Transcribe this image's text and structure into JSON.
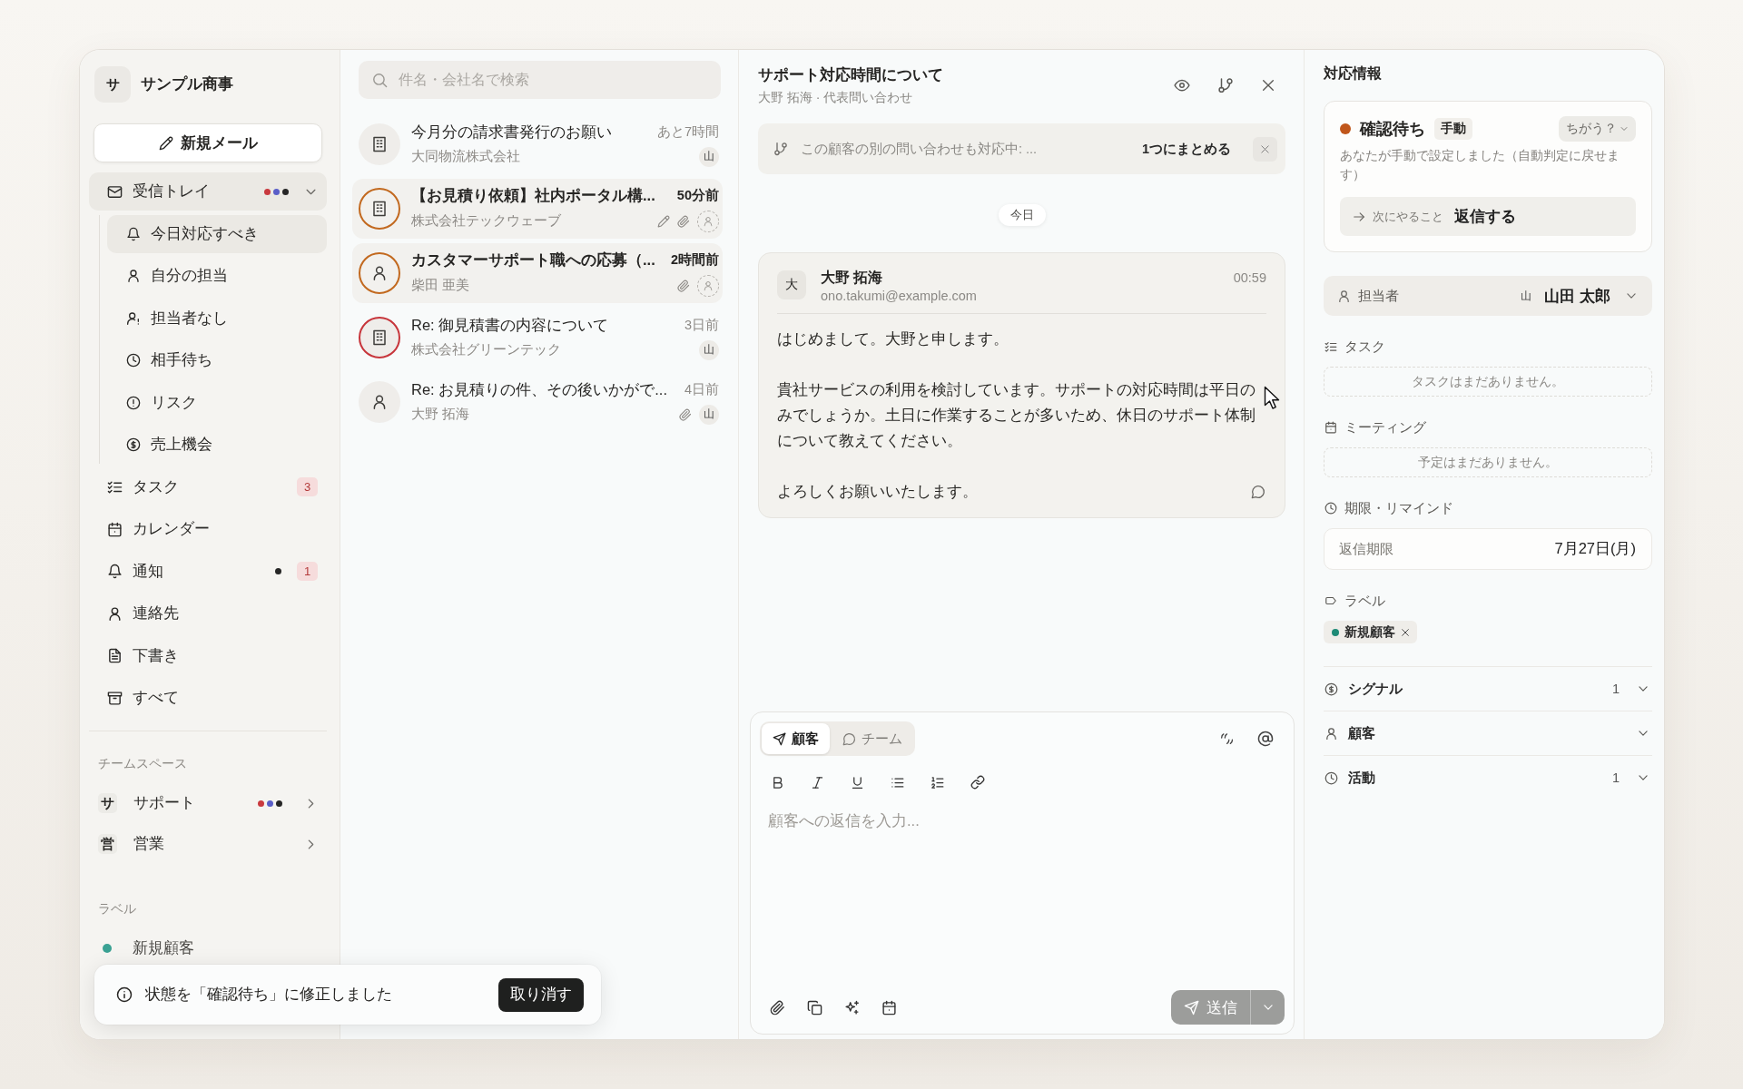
{
  "sidebar": {
    "workspace": {
      "initial": "サ",
      "name": "サンプル商事"
    },
    "compose_button": "新規メール",
    "folders": [
      {
        "label": "受信トレイ",
        "selected": true,
        "expanded": true,
        "dots": [
          {
            "color": "#c93a3f"
          },
          {
            "color": "#5a5ec8"
          },
          {
            "color": "#262626"
          }
        ],
        "children": [
          {
            "label": "今日対応すべき",
            "selected": true
          },
          {
            "label": "自分の担当",
            "selected": false
          },
          {
            "label": "担当者なし",
            "selected": false
          },
          {
            "label": "相手待ち",
            "selected": false
          },
          {
            "label": "リスク",
            "selected": false
          },
          {
            "label": "売上機会",
            "selected": false
          }
        ]
      },
      {
        "label": "タスク",
        "selected": false,
        "badge": "3"
      },
      {
        "label": "カレンダー",
        "selected": false
      },
      {
        "label": "通知",
        "selected": false,
        "dots": [
          {
            "color": "#262626"
          }
        ],
        "badge": "1"
      },
      {
        "label": "連絡先",
        "selected": false
      },
      {
        "label": "下書き",
        "selected": false
      },
      {
        "label": "すべて",
        "selected": false
      }
    ],
    "team_heading": "チームスペース",
    "teams": [
      {
        "initial": "サ",
        "label": "サポート",
        "expanded": false,
        "dots": [
          {
            "color": "#c93a3f"
          },
          {
            "color": "#5a5ec8"
          },
          {
            "color": "#262626"
          }
        ]
      },
      {
        "initial": "営",
        "label": "営業",
        "expanded": false
      }
    ],
    "labels_heading": "ラベル",
    "labels": [
      {
        "label": "新規顧客",
        "color": "#3aa193"
      }
    ]
  },
  "toast": {
    "message": "状態を「確認待ち」に修正しました",
    "action": "取り消す"
  },
  "threads": {
    "search_placeholder": "件名・会社名で検索",
    "items": [
      {
        "kind": "company",
        "subject": "今月分の請求書発行のお願い",
        "sender": "大同物流株式会社",
        "time": "あと7時間",
        "unread": false,
        "draft": false,
        "attachment": false,
        "assignee": "山"
      },
      {
        "kind": "company",
        "color": "#c2691f",
        "subject": "【お見積り依頼】社内ポータル構...",
        "sender": "株式会社テックウェーブ",
        "time": "50分前",
        "unread": true,
        "draft": true,
        "attachment": true
      },
      {
        "kind": "person",
        "color": "#c2691f",
        "subject": "カスタマーサポート職への応募（...",
        "sender": "柴田 亜美",
        "time": "2時間前",
        "unread": true,
        "draft": false,
        "attachment": true
      },
      {
        "kind": "company",
        "color": "#c7353b",
        "subject": "Re: 御見積書の内容について",
        "sender": "株式会社グリーンテック",
        "time": "3日前",
        "unread": false,
        "draft": false,
        "attachment": false,
        "assignee": "山"
      },
      {
        "kind": "person",
        "subject": "Re: お見積りの件、その後いかがで...",
        "sender": "大野 拓海",
        "time": "4日前",
        "unread": false,
        "draft": false,
        "attachment": true,
        "assignee": "山"
      }
    ]
  },
  "conversation": {
    "title": "サポート対応時間について",
    "subtitle": "大野 拓海 · 代表問い合わせ",
    "banner": {
      "text": "この顧客の別の問い合わせも対応中: ...",
      "action": "1つにまとめる"
    },
    "date_divider": "今日",
    "messages": [
      {
        "initial": "大",
        "sender": "大野 拓海",
        "email": "ono.takumi@example.com",
        "time": "00:59",
        "paragraphs": [
          "はじめまして。大野と申します。",
          "貴社サービスの利用を検討しています。サポートの対応時間は平日のみでしょうか。土日に作業することが多いため、休日のサポート体制について教えてください。",
          "よろしくお願いいたします。"
        ]
      }
    ]
  },
  "composer": {
    "tabs": [
      {
        "label": "顧客",
        "selected": true
      },
      {
        "label": "チーム",
        "selected": false
      }
    ],
    "placeholder": "顧客への返信を入力...",
    "send": {
      "label": "送信",
      "disabled": true
    }
  },
  "details": {
    "title": "対応情報",
    "status": {
      "label": "確認待ち",
      "mode": "手動",
      "change_button": "ちがう？",
      "description": "あなたが手動で設定しました（自動判定に戻せます）",
      "next_label": "次にやること",
      "next_action": "返信する"
    },
    "assignee": {
      "label": "担当者",
      "initial": "山",
      "name": "山田 太郎"
    },
    "sections": [
      {
        "kind": "empty",
        "title": "タスク",
        "empty_text": "タスクはまだありません。"
      },
      {
        "kind": "empty",
        "title": "ミーティング",
        "empty_text": "予定はまだありません。"
      },
      {
        "kind": "field",
        "title": "期限・リマインド",
        "field_label": "返信期限",
        "field_value": "7月27日(月)"
      },
      {
        "kind": "tags",
        "title": "ラベル",
        "tags": [
          {
            "label": "新規顧客",
            "color": "#1e8a76"
          }
        ]
      }
    ],
    "accordions": [
      {
        "label": "シグナル",
        "count": "1",
        "expanded": false
      },
      {
        "label": "顧客",
        "expanded": false
      },
      {
        "label": "活動",
        "count": "1",
        "expanded": false
      }
    ]
  }
}
